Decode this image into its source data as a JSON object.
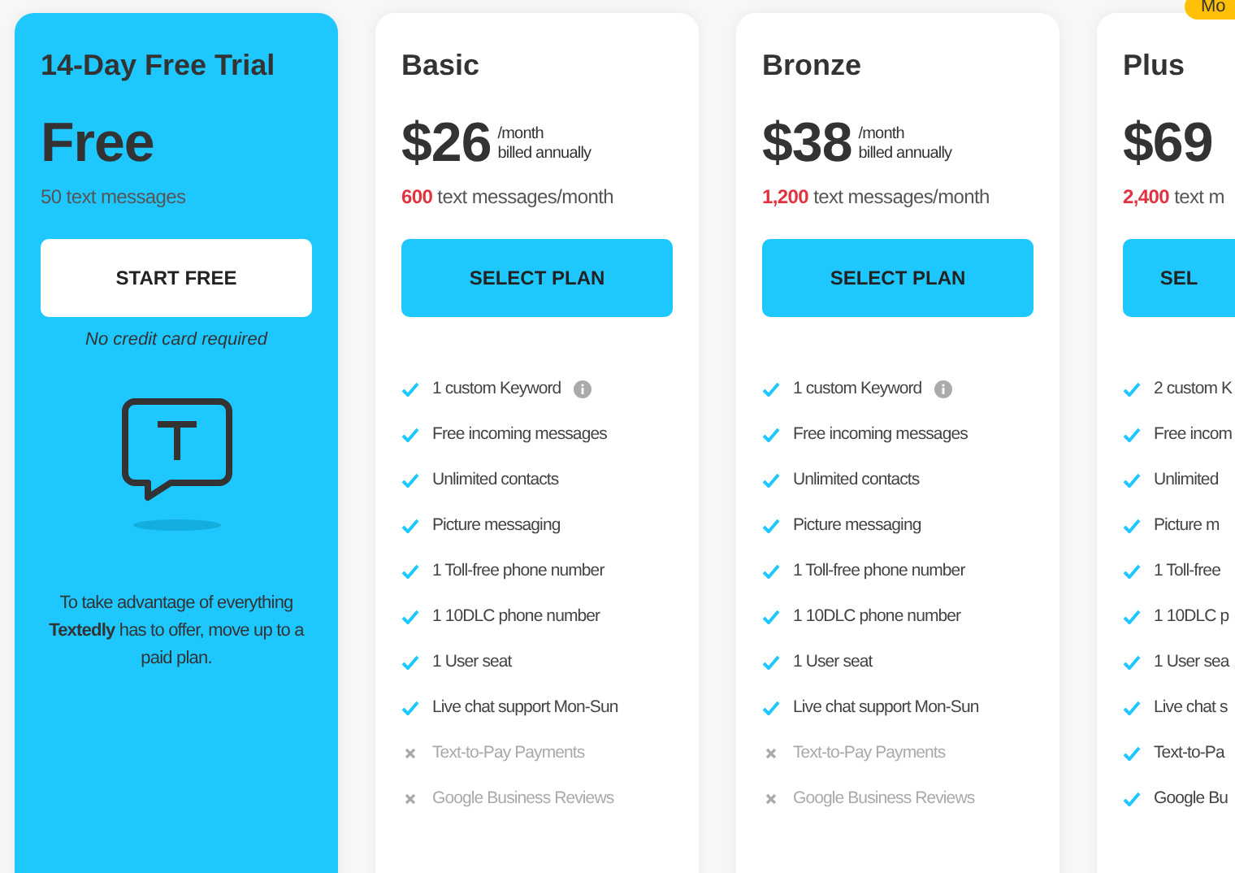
{
  "trial": {
    "title": "14-Day Free Trial",
    "price": "Free",
    "messages": "50 text messages",
    "button": "START FREE",
    "note": "No credit card required",
    "blurb": "To take advantage of everything **Textedly** has to offer, move up to a paid plan."
  },
  "plans": [
    {
      "name": "Basic",
      "price": "$26",
      "period": "/month",
      "billing": "billed annually",
      "count": "600",
      "unit": " text messages/month",
      "button": "SELECT PLAN",
      "features": [
        {
          "text": "1 custom Keyword",
          "included": true,
          "info": true
        },
        {
          "text": "Free incoming messages",
          "included": true,
          "info": false
        },
        {
          "text": "Unlimited contacts",
          "included": true,
          "info": false
        },
        {
          "text": "Picture messaging",
          "included": true,
          "info": false
        },
        {
          "text": "1 Toll-free phone number",
          "included": true,
          "info": false
        },
        {
          "text": "1 10DLC phone number",
          "included": true,
          "info": false
        },
        {
          "text": "1 User seat",
          "included": true,
          "info": false
        },
        {
          "text": "Live chat support Mon-Sun",
          "included": true,
          "info": false
        },
        {
          "text": "Text-to-Pay Payments",
          "included": false,
          "info": false
        },
        {
          "text": "Google Business Reviews",
          "included": false,
          "info": false
        }
      ]
    },
    {
      "name": "Bronze",
      "price": "$38",
      "period": "/month",
      "billing": "billed annually",
      "count": "1,200",
      "unit": " text messages/month",
      "button": "SELECT PLAN",
      "features": [
        {
          "text": "1 custom Keyword",
          "included": true,
          "info": true
        },
        {
          "text": "Free incoming messages",
          "included": true,
          "info": false
        },
        {
          "text": "Unlimited contacts",
          "included": true,
          "info": false
        },
        {
          "text": "Picture messaging",
          "included": true,
          "info": false
        },
        {
          "text": "1 Toll-free phone number",
          "included": true,
          "info": false
        },
        {
          "text": "1 10DLC phone number",
          "included": true,
          "info": false
        },
        {
          "text": "1 User seat",
          "included": true,
          "info": false
        },
        {
          "text": "Live chat support Mon-Sun",
          "included": true,
          "info": false
        },
        {
          "text": "Text-to-Pay Payments",
          "included": false,
          "info": false
        },
        {
          "text": "Google Business Reviews",
          "included": false,
          "info": false
        }
      ]
    },
    {
      "name": "Plus",
      "badge": "Mo",
      "price": "$69",
      "count": "2,400",
      "unit": " text m",
      "button": "SEL",
      "features": [
        {
          "text": "2 custom K",
          "included": true,
          "info": false
        },
        {
          "text": "Free incom",
          "included": true,
          "info": false
        },
        {
          "text": "Unlimited",
          "included": true,
          "info": false
        },
        {
          "text": "Picture m",
          "included": true,
          "info": false
        },
        {
          "text": "1 Toll-free",
          "included": true,
          "info": false
        },
        {
          "text": "1 10DLC p",
          "included": true,
          "info": false
        },
        {
          "text": "1 User sea",
          "included": true,
          "info": false
        },
        {
          "text": "Live chat s",
          "included": true,
          "info": false
        },
        {
          "text": "Text-to-Pa",
          "included": true,
          "info": false
        },
        {
          "text": "Google Bu",
          "included": true,
          "info": false
        }
      ]
    }
  ]
}
